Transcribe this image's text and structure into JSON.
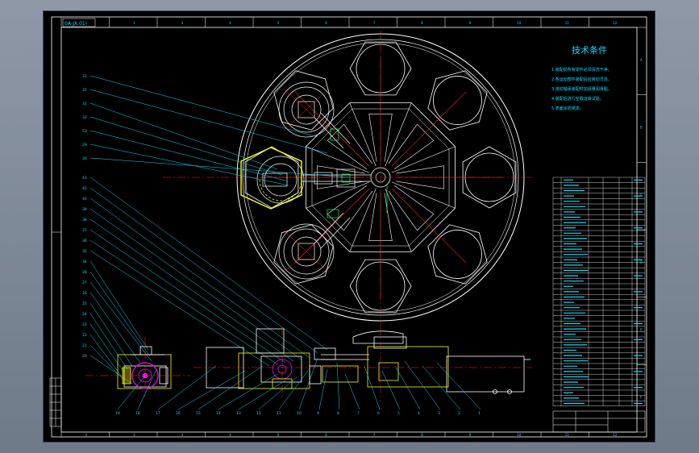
{
  "title_tag": "0A-JX.01",
  "tech_title": "技术条件",
  "tech_notes": [
    "1.装配前所有零件必须清洗干净。",
    "2.各运动部件装配后应转动灵活。",
    "3.滚动轴承装配时加适量润滑脂。",
    "4.装配后进行空载运转试验。",
    "5.表面涂防锈漆。"
  ],
  "balloons_left": [
    "33",
    "35",
    "31",
    "32",
    "53",
    "29",
    "30",
    "43",
    "42",
    "40",
    "39",
    "38",
    "37",
    "36",
    "35",
    "34",
    "28",
    "27",
    "26",
    "25",
    "24",
    "23",
    "22",
    "21",
    "20"
  ],
  "balloons_bottom": [
    "19",
    "18",
    "17",
    "16",
    "15",
    "14",
    "13",
    "12",
    "11",
    "10",
    "9",
    "8",
    "7",
    "6",
    "5",
    "4",
    "3",
    "2",
    "1"
  ],
  "grid_top": [
    "1",
    "2",
    "3",
    "4",
    "5",
    "6",
    "7",
    "8",
    "9",
    "10",
    "11",
    "12"
  ],
  "grid_side": [
    "A",
    "B",
    "C",
    "D",
    "E",
    "F"
  ],
  "colors": {
    "frame": "#ffffff",
    "leader": "#00e0ff",
    "center": "#ff2a2a",
    "part": "#ffff00",
    "accent": "#ff00ff",
    "green": "#00ff66",
    "text": "#00e0ff"
  }
}
